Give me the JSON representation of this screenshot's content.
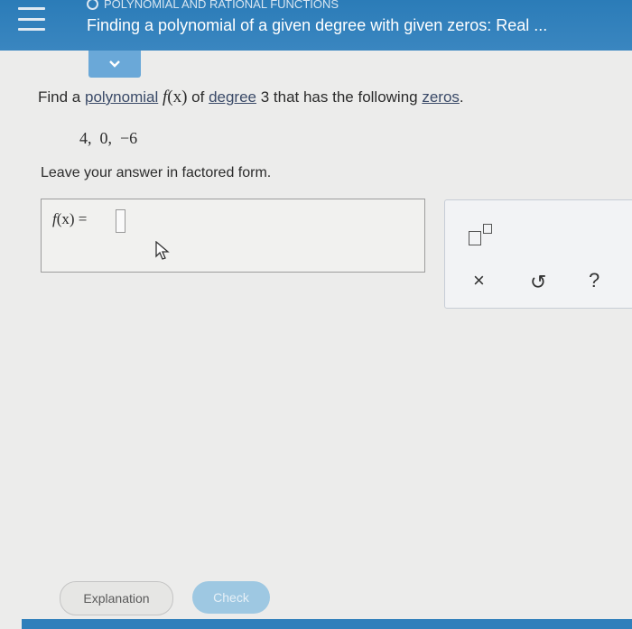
{
  "header": {
    "section_label": "POLYNOMIAL AND RATIONAL FUNCTIONS",
    "topic_title": "Finding a polynomial of a given degree with given zeros: Real ..."
  },
  "question": {
    "prefix": "Find a ",
    "link_polynomial": "polynomial",
    "function_name": "f",
    "function_arg": "(x)",
    "middle": " of ",
    "link_degree": "degree",
    "degree_value": " 3 that has the following ",
    "link_zeros": "zeros",
    "suffix": ".",
    "zeros": "4,  0,  −6",
    "instruction": "Leave your answer in factored form."
  },
  "answer": {
    "label_f": "f",
    "label_rest": "(x)  =",
    "value": ""
  },
  "tools": {
    "exponent_icon": "exponent-template-icon",
    "clear_glyph": "×",
    "undo_glyph": "↺",
    "help_glyph": "?"
  },
  "footer": {
    "explanation_label": "Explanation",
    "check_label": "Check"
  },
  "colors": {
    "header_blue": "#2b7cb8",
    "tab_blue": "#6aa8d8",
    "check_blue": "#9ec8e2"
  }
}
